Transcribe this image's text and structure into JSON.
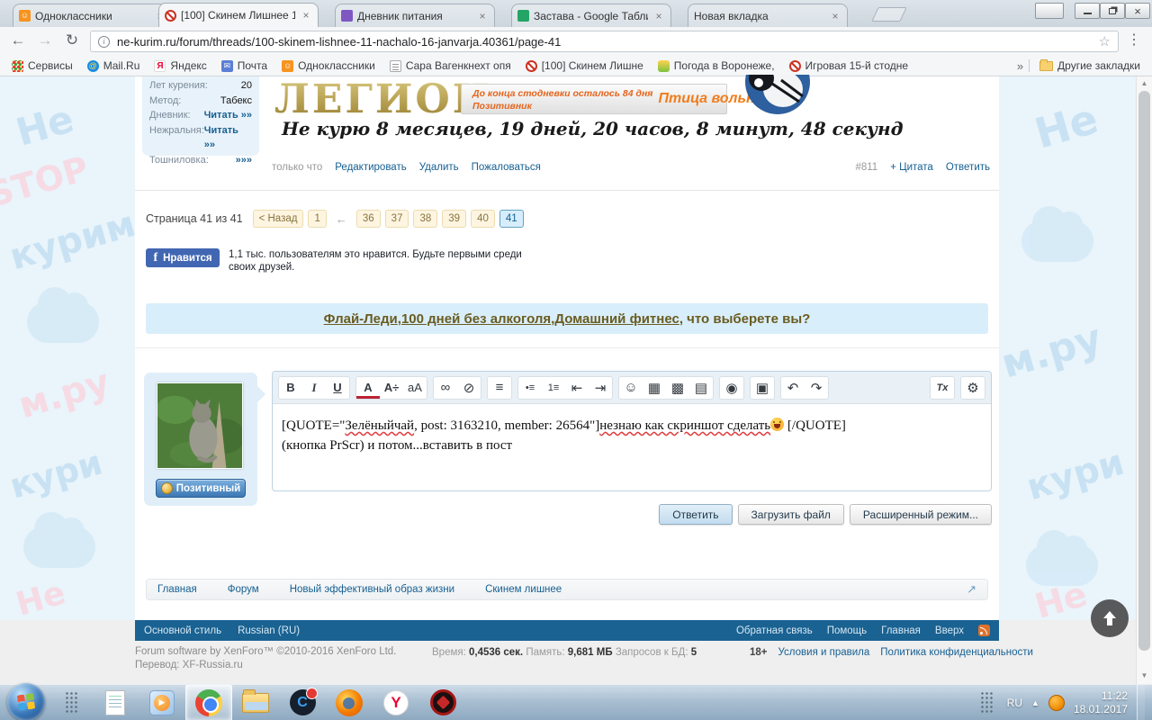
{
  "browser": {
    "tabs": [
      {
        "title": "Одноклассники"
      },
      {
        "title": "[100] Скинем Лишнее 1"
      },
      {
        "title": "Дневник питания"
      },
      {
        "title": "Застава - Google Табли"
      },
      {
        "title": "Новая вкладка"
      }
    ],
    "url": "ne-kurim.ru/forum/threads/100-skinem-lishnee-11-nachalo-16-janvarja.40361/page-41",
    "bookmarks": [
      {
        "label": "Сервисы"
      },
      {
        "label": "Mail.Ru"
      },
      {
        "label": "Яндекс"
      },
      {
        "label": "Почта"
      },
      {
        "label": "Одноклассники"
      },
      {
        "label": "Сара Вагенкнехт опя"
      },
      {
        "label": "[100] Скинем Лишне"
      },
      {
        "label": "Погода в Воронеже,"
      },
      {
        "label": "Игровая 15-й стодне"
      }
    ],
    "more_bookmarks": "»",
    "other_bookmarks": "Другие закладки"
  },
  "glyphs": {
    "back": "←",
    "forward": "→",
    "reload": "↻",
    "star": "☆",
    "menu": "⋮",
    "close": "×",
    "info": "i",
    "ext": "↗",
    "tray_arrow": "▲",
    "sb_up": "▲",
    "sb_dn": "▼",
    "fb_logo": "f",
    "wmp_play": "▶",
    "capp": "C",
    "yandex": "Y"
  },
  "watermark": {
    "w1": "Не",
    "w2": "курим.ру",
    "w3": "STOP",
    "w4": "м.ру",
    "w5": "кури"
  },
  "post": {
    "user_info": [
      {
        "label": "Лет курения:",
        "value": "20"
      },
      {
        "label": "Метод:",
        "value": "Табекс"
      },
      {
        "label": "Дневник:",
        "value": "Читать »»"
      },
      {
        "label": "Нежральня:",
        "value": "Читать »»"
      },
      {
        "label": "Тошниловка:",
        "value": "»»»"
      }
    ],
    "signature": {
      "legion": "ЛЕГИОН",
      "badge_line1": "До конца стодневки осталось 84 дня",
      "badge_line2": "Позитивник",
      "badge_line3": "Птица вольная",
      "counter": "Не курю  8 месяцев, 19 дней, 20 часов, 8 минут, 48 секунд"
    },
    "meta": {
      "time": "только что",
      "edit": "Редактировать",
      "delete": "Удалить",
      "report": "Пожаловаться",
      "number": "#811",
      "quote": "+ Цитата",
      "reply": "Ответить"
    }
  },
  "pagination": {
    "label": "Страница 41 из 41",
    "prev": "< Назад",
    "first": "1",
    "gap": "←",
    "pages": [
      "36",
      "37",
      "38",
      "39",
      "40"
    ],
    "current": "41"
  },
  "facebook": {
    "button": "Нравится",
    "text": "1,1 тыс. пользователям это нравится. Будьте первыми среди своих друзей."
  },
  "banner": {
    "link1": "Флай-Леди",
    "sep": ", ",
    "link2": "100 дней без алкоголя",
    "link3": "Домашний фитнес",
    "tail": ", что выберете вы?"
  },
  "editor": {
    "badge": "Позитивный",
    "toolbar": {
      "bold": "B",
      "italic": "I",
      "underline": "U",
      "color": "A",
      "size": "A÷",
      "font": "aA",
      "link": "∞",
      "unlink": "⊘",
      "align": "≡",
      "ul": "•≡",
      "ol": "1≡",
      "outdent": "⇤",
      "indent": "⇥",
      "smiley": "☺",
      "image": "▦",
      "film": "▩",
      "quote": "▤",
      "camera": "◉",
      "save": "▣",
      "undo": "↶",
      "redo": "↷",
      "removeformat": "Tx",
      "source": "⚙"
    },
    "content": {
      "p1": "[QUOTE=\"",
      "p2": "Зелёныйчай",
      "p3": ", post: 3163210, member: 26564\"]",
      "p4": "незнаю как скриншот сделать",
      "p5": " [/QUOTE]",
      "line2": "(кнопка PrScr)  и потом...вставить в пост"
    },
    "buttons": {
      "reply": "Ответить",
      "upload": "Загрузить файл",
      "advanced": "Расширенный режим..."
    }
  },
  "breadcrumb": {
    "items": [
      "Главная",
      "Форум",
      "Новый эффективный образ жизни",
      "Скинем лишнее"
    ]
  },
  "footer_bar": {
    "style": "Основной стиль",
    "lang": "Russian (RU)",
    "feedback": "Обратная связь",
    "help": "Помощь",
    "home": "Главная",
    "top": "Вверх"
  },
  "footer": {
    "copyright": "Forum software by XenForo™ ©2010-2016 XenForo Ltd.",
    "translation": "Перевод: XF-Russia.ru",
    "stats_time_label": "Время:",
    "stats_time": "0,4536 сек.",
    "stats_mem_label": "Память:",
    "stats_mem": "9,681 МБ",
    "stats_db_label": "Запросов к БД:",
    "stats_db": "5",
    "age": "18+",
    "terms": "Условия и правила",
    "privacy": "Политика конфиденциальности"
  },
  "taskbar": {
    "lang": "RU",
    "time": "11:22",
    "date": "18.01.2017"
  }
}
